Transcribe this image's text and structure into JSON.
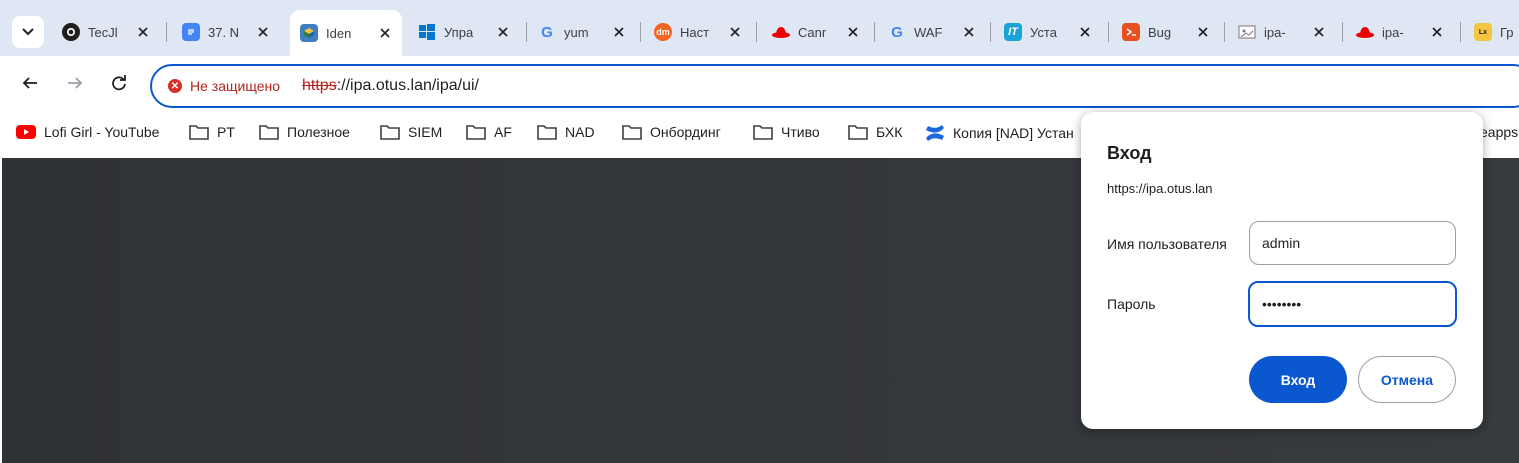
{
  "colors": {
    "accent": "#0b57d0",
    "insecure": "#b3261e",
    "tabstrip_bg": "#dfe6f4",
    "page_bg": "#35383d"
  },
  "tabs": [
    {
      "title": "TecJl",
      "icon": "github-icon",
      "active": false
    },
    {
      "title": "37. N",
      "icon": "google-docs-icon",
      "active": false
    },
    {
      "title": "Iden",
      "icon": "freeipa-icon",
      "active": true
    },
    {
      "title": "Упра",
      "icon": "windows-icon",
      "active": false
    },
    {
      "title": "yum",
      "icon": "google-icon",
      "active": false
    },
    {
      "title": "Наст",
      "icon": "dm-icon",
      "active": false
    },
    {
      "title": "Canr",
      "icon": "redhat-icon",
      "active": false
    },
    {
      "title": "WAF",
      "icon": "google-icon",
      "active": false
    },
    {
      "title": "Уста",
      "icon": "it-icon",
      "active": false
    },
    {
      "title": "Bug",
      "icon": "habr-icon",
      "active": false
    },
    {
      "title": "ipa-",
      "icon": "image-icon",
      "active": false
    },
    {
      "title": "ipa-",
      "icon": "redhat-icon",
      "active": false
    },
    {
      "title": "Гр",
      "icon": "linux-icon",
      "active": false
    }
  ],
  "omnibox": {
    "security_label": "Не защищено",
    "url_scheme": "https",
    "url_rest": "://ipa.otus.lan/ipa/ui/"
  },
  "bookmarks": [
    {
      "label": "Lofi Girl - YouTube",
      "icon": "youtube-icon"
    },
    {
      "label": "PT",
      "icon": "folder-icon"
    },
    {
      "label": "Полезное",
      "icon": "folder-icon"
    },
    {
      "label": "SIEM",
      "icon": "folder-icon"
    },
    {
      "label": "AF",
      "icon": "folder-icon"
    },
    {
      "label": "NAD",
      "icon": "folder-icon"
    },
    {
      "label": "Онбординг",
      "icon": "folder-icon"
    },
    {
      "label": "Чтиво",
      "icon": "folder-icon"
    },
    {
      "label": "БХК",
      "icon": "folder-icon"
    },
    {
      "label": "Копия [NAD] Устан",
      "icon": "confluence-icon"
    },
    {
      "label": "eapps",
      "icon": "none"
    }
  ],
  "dialog": {
    "title": "Вход",
    "origin": "https://ipa.otus.lan",
    "username_label": "Имя пользователя",
    "username_value": "admin",
    "password_label": "Пароль",
    "password_value": "••••••••",
    "submit_label": "Вход",
    "cancel_label": "Отмена"
  }
}
